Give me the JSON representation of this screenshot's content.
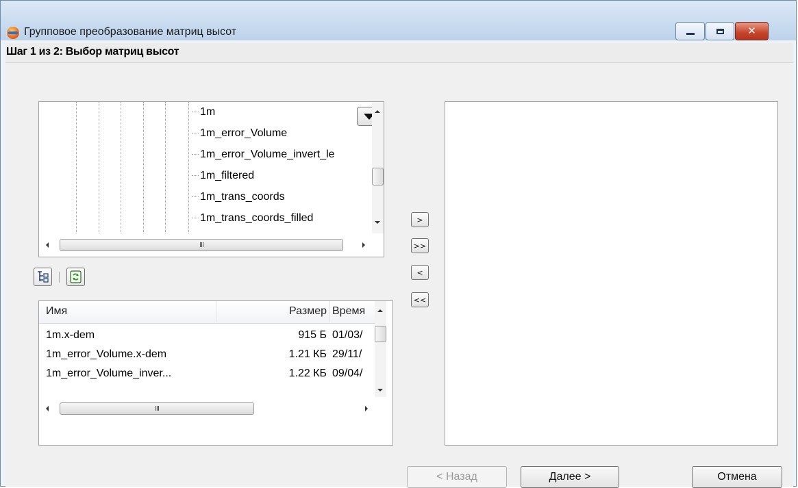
{
  "window": {
    "title": "Групповое преобразование матриц высот",
    "close_glyph": "✕"
  },
  "step": {
    "text": "Шаг 1 из 2: Выбор матриц высот"
  },
  "tree": {
    "items": [
      "1m",
      "1m_error_Volume",
      "1m_error_Volume_invert_le",
      "1m_filtered",
      "1m_trans_coords",
      "1m_trans_coords_filled"
    ],
    "hscroll_grip": "III"
  },
  "toolbar": {
    "tree_view_icon": "tree-view-icon",
    "refresh_icon": "refresh-icon"
  },
  "file_list": {
    "columns": [
      "Имя",
      "Размер",
      "Время"
    ],
    "rows": [
      {
        "name": "1m.x-dem",
        "size": "915 Б",
        "time": "01/03/"
      },
      {
        "name": "1m_error_Volume.x-dem",
        "size": "1.21 КБ",
        "time": "29/11/"
      },
      {
        "name": "1m_error_Volume_inver...",
        "size": "1.22 КБ",
        "time": "09/04/"
      }
    ],
    "hscroll_grip": "III"
  },
  "move_buttons": {
    "add": ">",
    "add_all": ">>",
    "remove": "<",
    "remove_all": "<<"
  },
  "buttons": {
    "back": "< Назад",
    "next": "Далее >",
    "cancel": "Отмена"
  }
}
